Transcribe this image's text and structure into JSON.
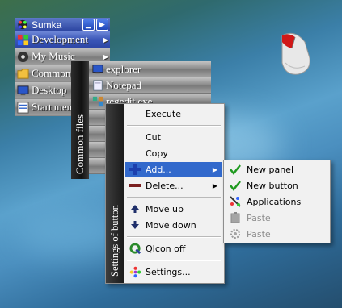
{
  "panel1": {
    "title": "Sumka",
    "items": [
      {
        "label": "Development",
        "icon": "development-icon",
        "has_submenu": true,
        "selected": true
      },
      {
        "label": "My Music",
        "icon": "music-icon",
        "has_submenu": true,
        "selected": false
      },
      {
        "label": "Common",
        "icon": "folder-icon",
        "has_submenu": false,
        "selected": false
      },
      {
        "label": "Desktop",
        "icon": "desktop-icon",
        "has_submenu": false,
        "selected": false
      },
      {
        "label": "Start menu",
        "icon": "start-menu-icon",
        "has_submenu": false,
        "selected": false
      }
    ]
  },
  "panel2": {
    "title": "Common files",
    "items": [
      {
        "label": "explorer",
        "icon": "explorer-icon"
      },
      {
        "label": "Notepad",
        "icon": "notepad-icon"
      },
      {
        "label": "regedit.exe",
        "icon": "regedit-icon"
      }
    ]
  },
  "context_menu": {
    "title": "Settings of button",
    "items": [
      {
        "label": "Execute",
        "icon": ""
      },
      {
        "label": "Cut",
        "icon": ""
      },
      {
        "label": "Copy",
        "icon": ""
      },
      {
        "label": "Add...",
        "icon": "plus-icon",
        "has_submenu": true
      },
      {
        "label": "Delete...",
        "icon": "minus-icon",
        "has_submenu": true
      },
      {
        "label": "Move up",
        "icon": "arrow-up-icon"
      },
      {
        "label": "Move down",
        "icon": "arrow-down-icon"
      },
      {
        "label": "QIcon off",
        "icon": "qicon-icon"
      },
      {
        "label": "Settings...",
        "icon": "settings-icon"
      }
    ]
  },
  "submenu": {
    "items": [
      {
        "label": "New panel",
        "icon": "checkmark-icon",
        "enabled": true
      },
      {
        "label": "New button",
        "icon": "checkmark-icon",
        "enabled": true
      },
      {
        "label": "Applications",
        "icon": "applications-icon",
        "enabled": true
      },
      {
        "label": "Paste",
        "icon": "paste-icon",
        "enabled": false
      },
      {
        "label": "Paste",
        "icon": "paste-special-icon",
        "enabled": false
      }
    ]
  },
  "colors": {
    "menu_highlight": "#3269cc",
    "panel_title": "#2b43a0",
    "check_green": "#1f9a1f"
  }
}
